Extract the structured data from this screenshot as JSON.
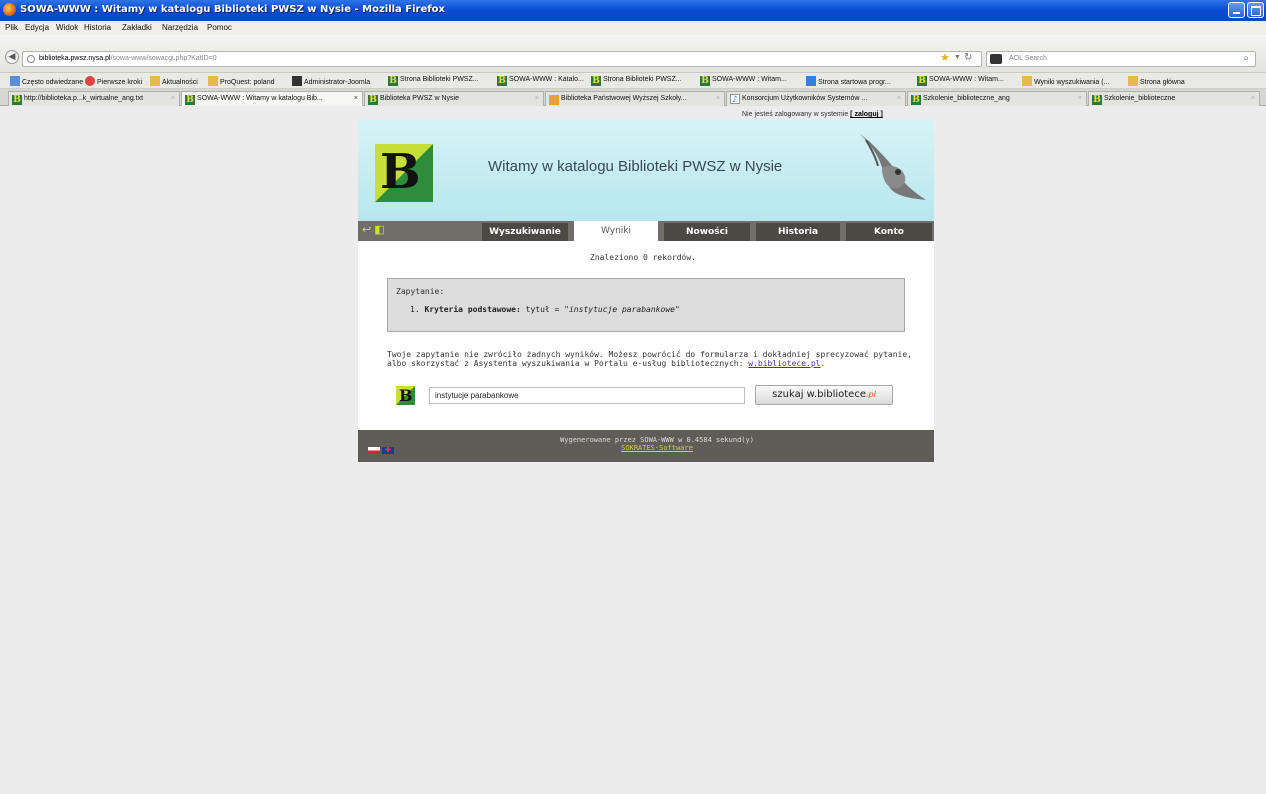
{
  "window": {
    "title": "SOWA-WWW : Witamy w katalogu Biblioteki PWSZ w Nysie - Mozilla Firefox"
  },
  "menu": [
    "Plik",
    "Edycja",
    "Widok",
    "Historia",
    "Zakładki",
    "Narzędzia",
    "Pomoc"
  ],
  "address_bar": {
    "host": "biblioteka.pwsz.nysa.pl",
    "path": "/sowa-www/sowacgi.php?KatID=0",
    "search_placeholder": "AOL Search"
  },
  "bookmarks": [
    "Często odwiedzane",
    "Pierwsze kroki",
    "Aktualności",
    "ProQuest: poland",
    "Administrator-Joomla",
    "Strona Biblioteki PWSZ...",
    "SOWA-WWW : Katalo...",
    "Strona Biblioteki PWSZ...",
    "SOWA-WWW : Witam...",
    "Strona startowa progr...",
    "SOWA-WWW : Witam...",
    "Wyniki wyszukiwania (...",
    "Strona główna"
  ],
  "tabs": [
    "http://biblioteka.p...k_wirtualne_ang.txt",
    "SOWA-WWW : Witamy w katalogu Bib...",
    "Biblioteka PWSZ w Nysie",
    "Biblioteka Państwowej Wyższej Szkoły...",
    "Konsorcjum Użytkowników Systemów ...",
    "Szkolenie_biblioteczne_ang",
    "Szkolenie_biblioteczne"
  ],
  "page": {
    "login_text": "Nie jesteś zalogowany w systemie",
    "login_link": "[ zaloguj ]",
    "logo_letter": "B",
    "header_title": "Witamy w katalogu Biblioteki PWSZ w Nysie",
    "nav": [
      "Wyszukiwanie",
      "Wyniki",
      "Nowości",
      "Historia",
      "Konto"
    ],
    "found": "Znaleziono 0 rekordów.",
    "query_label": "Zapytanie:",
    "query_num": "1.",
    "query_key": "Kryteria podstawowe:",
    "query_field": "tytuł =",
    "query_value": "\"instytucje parabankowe\"",
    "message": "Twoje zapytanie nie zwróciło żadnych wyników. Możesz powrócić do formularza i dokładniej sprecyzować pytanie, albo skorzystać z Asystenta wyszukiwania w Portalu e-usług bibliotecznych:",
    "message_link": "w.bibliotece.pl",
    "search_value": "instytucje parabankowe",
    "search_button": "szukaj w.biblioteceˌpl",
    "search_button_main": "szukaj w.bibliotece",
    "search_button_pl": ".pl",
    "footer_generated": "Wygenerowane przez SOWA-WWW w 0.4584 sekund(y)",
    "footer_link": "SOKRATES-Software"
  }
}
